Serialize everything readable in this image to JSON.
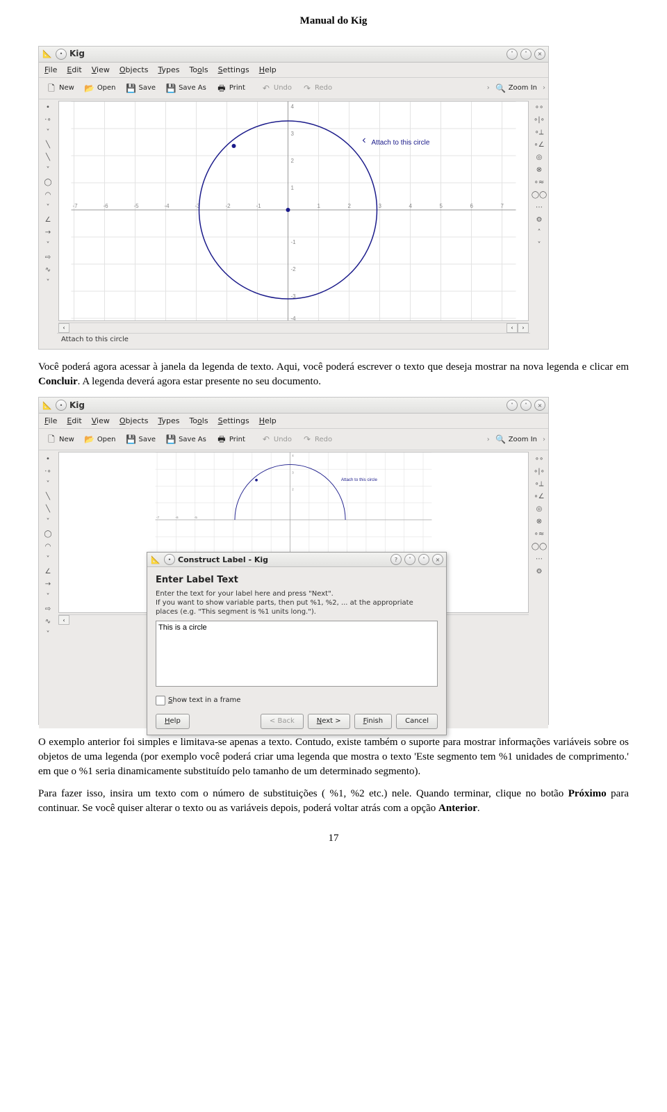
{
  "title": "Manual do Kig",
  "app": {
    "name": "Kig",
    "menus": [
      "File",
      "Edit",
      "View",
      "Objects",
      "Types",
      "Tools",
      "Settings",
      "Help"
    ],
    "toolbar": {
      "new": "New",
      "open": "Open",
      "save": "Save",
      "saveas": "Save As",
      "print": "Print",
      "undo": "Undo",
      "redo": "Redo",
      "zoomin": "Zoom In"
    },
    "tooltip": "Attach to this circle",
    "status": "Attach to this circle",
    "ticks_x": [
      "-7",
      "-6",
      "-5",
      "-4",
      "-3",
      "-2",
      "-1",
      "1",
      "2",
      "3",
      "4",
      "5",
      "6",
      "7"
    ],
    "ticks_y": [
      "4",
      "3",
      "2",
      "1",
      "-1",
      "-2",
      "-3",
      "-4"
    ]
  },
  "para1_a": "Você poderá agora acessar à janela da legenda de texto. Aqui, você poderá escrever o texto que deseja mostrar na nova legenda e clicar em ",
  "para1_b": "Concluir",
  "para1_c": ". A legenda deverá agora estar presente no seu documento.",
  "dialog": {
    "title": "Construct Label - Kig",
    "heading": "Enter Label Text",
    "hint1": "Enter the text for your label here and press \"Next\".",
    "hint2": "If you want to show variable parts, then put %1, %2, ... at the appropriate places (e.g. \"This segment is %1 units long.\").",
    "value": "This is a circle",
    "checkbox": "Show text in a frame",
    "buttons": {
      "help": "Help",
      "back": "< Back",
      "next": "Next >",
      "finish": "Finish",
      "cancel": "Cancel"
    }
  },
  "para2": "O exemplo anterior foi simples e limitava-se apenas a texto. Contudo, existe também o suporte para mostrar informações variáveis sobre os objetos de uma legenda (por exemplo você poderá criar uma legenda que mostra o texto 'Este segmento tem %1 unidades de comprimento.' em que o %1 seria dinamicamente substituído pelo tamanho de um determinado segmento).",
  "para3_a": "Para fazer isso, insira um texto com o número de substituições ( %1, %2 etc.) nele. Quando terminar, clique no botão ",
  "para3_b": "Próximo",
  "para3_c": " para continuar. Se você quiser alterar o texto ou as variáveis depois, poderá voltar atrás com a opção ",
  "para3_d": "Anterior",
  "para3_e": ".",
  "pagenum": "17",
  "chart_data": {
    "type": "scatter",
    "xlim": [
      -7,
      7
    ],
    "ylim": [
      -4,
      4
    ],
    "circle": {
      "cx": 0,
      "cy": 0,
      "r": 3
    },
    "points": [
      {
        "x": -1.8,
        "y": 2.4
      },
      {
        "x": 0,
        "y": 0
      }
    ]
  }
}
